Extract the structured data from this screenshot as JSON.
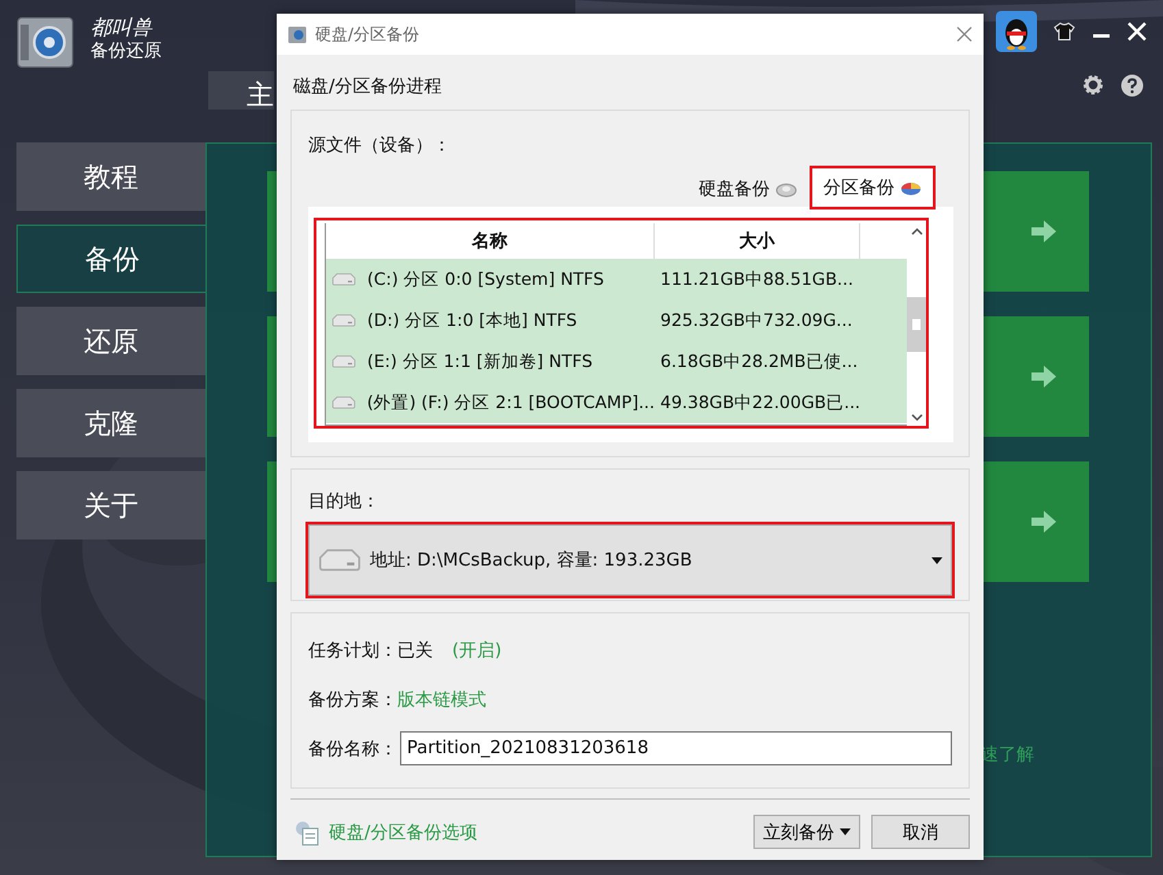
{
  "app": {
    "logo_title": "都叫兽",
    "logo_subtitle": "备份还原",
    "main_tab": "主",
    "nav": [
      {
        "label": "教程",
        "selected": false
      },
      {
        "label": "备份",
        "selected": true
      },
      {
        "label": "还原",
        "selected": false
      },
      {
        "label": "克隆",
        "selected": false
      },
      {
        "label": "关于",
        "selected": false
      }
    ],
    "cards": [
      {
        "kind": "arrow"
      },
      {
        "kind": "arrow"
      },
      {
        "kind": "arrow"
      }
    ],
    "hint_link": "速了解"
  },
  "dialog": {
    "title": "硬盘/分区备份",
    "heading": "磁盘/分区备份进程",
    "source_label": "源文件（设备）：",
    "source_tabs": [
      {
        "label": "硬盘备份",
        "kind": "disk",
        "selected": false
      },
      {
        "label": "分区备份",
        "kind": "partition",
        "selected": true
      }
    ],
    "table": {
      "columns": [
        "名称",
        "大小"
      ],
      "rows": [
        {
          "name": "(C:) 分区 0:0 [System] NTFS",
          "size": "111.21GB中88.51GB...",
          "selected": true
        },
        {
          "name": "(D:) 分区 1:0 [本地] NTFS",
          "size": "925.32GB中732.09G...",
          "selected": true
        },
        {
          "name": "(E:) 分区 1:1 [新加卷] NTFS",
          "size": "6.18GB中28.2MB已使...",
          "selected": true
        },
        {
          "name": "(外置)  (F:) 分区 2:1 [BOOTCAMP]...",
          "size": "49.38GB中22.00GB已...",
          "selected": true
        }
      ]
    },
    "destination_label": "目的地：",
    "destination": "地址: D:\\MCsBackup, 容量: 193.23GB",
    "schedule_label": "任务计划：",
    "schedule_value": "已关",
    "schedule_link": "(开启)",
    "scheme_label": "备份方案：",
    "scheme_link": "版本链模式",
    "name_label": "备份名称：",
    "name_value": "Partition_20210831203618",
    "options_link": "硬盘/分区备份选项",
    "buttons": [
      {
        "label": "立刻备份",
        "kind": "menu"
      },
      {
        "label": "取消",
        "kind": "plain"
      }
    ]
  }
}
